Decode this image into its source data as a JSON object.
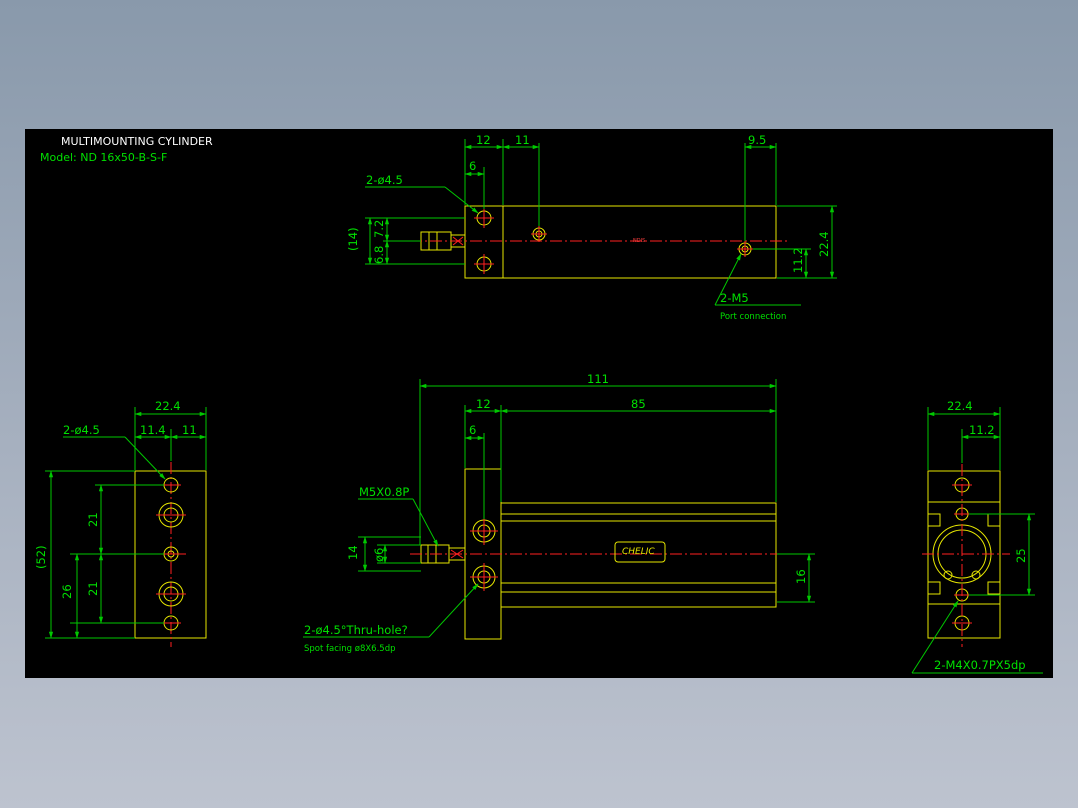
{
  "title": {
    "line1": "MULTIMOUNTING CYLINDER",
    "line2": "Model:  ND 16x50-B-S-F"
  },
  "top_view": {
    "dim_12": "12",
    "dim_11": "11",
    "dim_9_5": "9.5",
    "dim_6": "6",
    "hole_label": "2-ø4.5",
    "dim_14": "(14)",
    "dim_6_8": "6.8",
    "dim_7_2": "7.2",
    "dim_22_4": "22.4",
    "dim_11_2": "11.2",
    "port_label": "2-M5",
    "port_sub": "Port connection"
  },
  "front_view": {
    "dim_111": "111",
    "dim_12": "12",
    "dim_85": "85",
    "dim_6": "6",
    "thread_label": "M5X0.8P",
    "dim_14": "14",
    "dim_phi6": "ø6",
    "dim_16": "16",
    "brand": "CHELIC",
    "hole_label": "2-ø4.5°Thru-hole?",
    "spot_label": "Spot facing  ø8X6.5dp"
  },
  "left_view": {
    "dim_22_4": "22.4",
    "hole_label": "2-ø4.5",
    "dim_11_4": "11.4",
    "dim_11": "11",
    "dim_52": "(52)",
    "dim_21a": "21",
    "dim_21b": "21",
    "dim_26": "26"
  },
  "right_view": {
    "dim_22_4": "22.4",
    "dim_11_2": "11.2",
    "dim_25": "25",
    "thread_label": "2-M4X0.7PX5dp"
  }
}
